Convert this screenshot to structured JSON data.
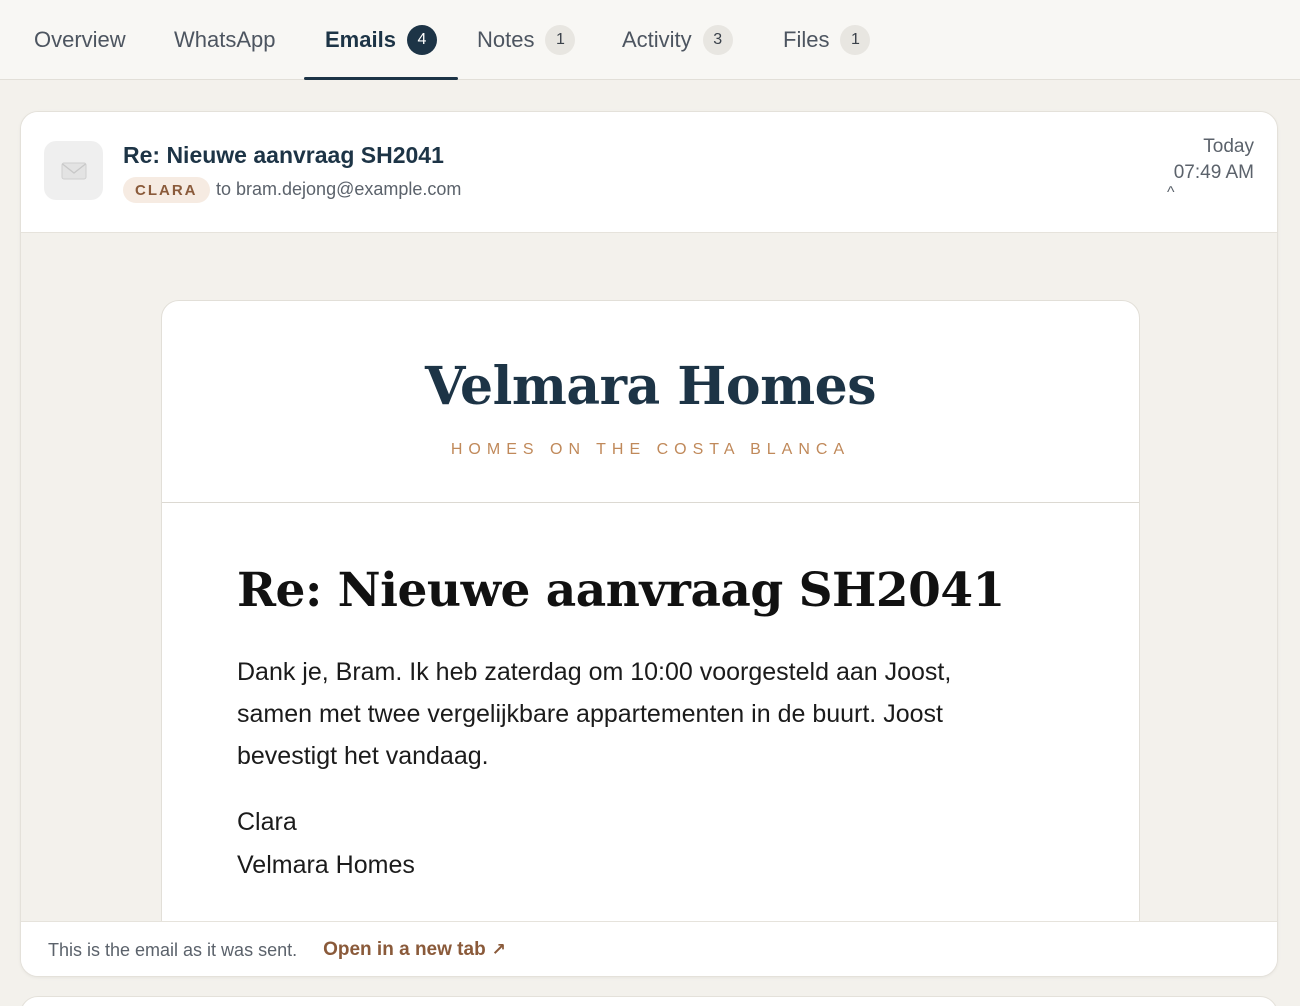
{
  "tabs": [
    {
      "label": "Overview",
      "count": null
    },
    {
      "label": "WhatsApp",
      "count": null
    },
    {
      "label": "Emails",
      "count": "4"
    },
    {
      "label": "Notes",
      "count": "1"
    },
    {
      "label": "Activity",
      "count": "3"
    },
    {
      "label": "Files",
      "count": "1"
    }
  ],
  "active_tab": "Emails",
  "email": {
    "subject": "Re: Nieuwe aanvraag SH2041",
    "sender_tag": "CLARA",
    "recipient": "to bram.dejong@example.com",
    "date_day": "Today",
    "date_time": "07:49 AM",
    "collapse_glyph": "^",
    "icon": "envelope-icon"
  },
  "email_content": {
    "brand_name": "Velmara Homes",
    "brand_tagline": "HOMES ON THE COSTA BLANCA",
    "heading": "Re: Nieuwe aanvraag SH2041",
    "paragraph": "Dank je, Bram. Ik heb zaterdag om 10:00 voorgesteld aan Joost, samen met twee vergelijkbare appartementen in de buurt. Joost bevestigt het vandaag.",
    "signature_name": "Clara",
    "signature_company": "Velmara Homes"
  },
  "footer": {
    "note": "This is the email as it was sent.",
    "open_link": "Open in a new tab",
    "open_link_icon": "external-arrow-icon",
    "open_link_glyph": "↗"
  },
  "colors": {
    "primary": "#1d3446",
    "accent": "#c0895a",
    "link": "#8a5a3a",
    "background": "#f3f1ec"
  }
}
